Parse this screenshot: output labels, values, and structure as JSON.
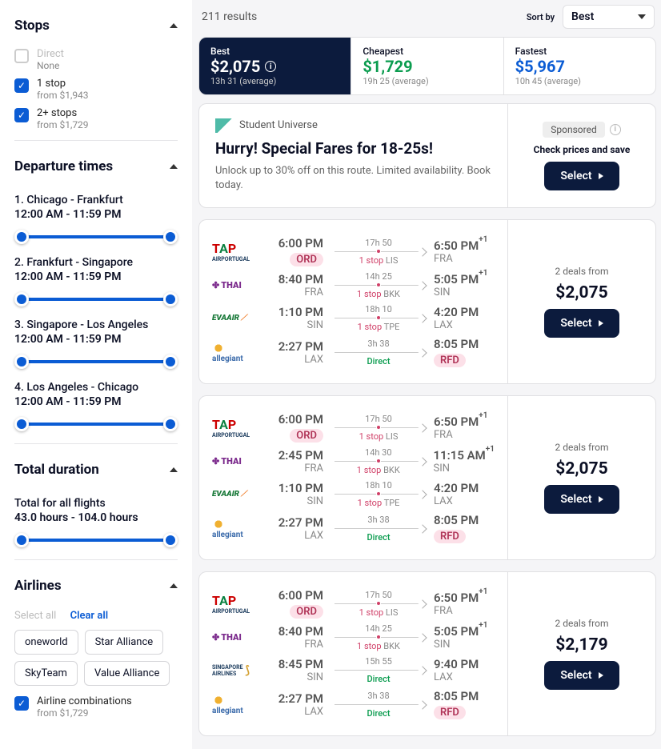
{
  "sidebar": {
    "stops": {
      "title": "Stops",
      "items": [
        {
          "label": "Direct",
          "sub": "None",
          "checked": false,
          "disabled": true
        },
        {
          "label": "1 stop",
          "sub": "from $1,943",
          "checked": true
        },
        {
          "label": "2+ stops",
          "sub": "from $1,729",
          "checked": true
        }
      ]
    },
    "departure": {
      "title": "Departure times",
      "legs": [
        {
          "label": "1. Chicago - Frankfurt",
          "range": "12:00 AM - 11:59 PM"
        },
        {
          "label": "2. Frankfurt - Singapore",
          "range": "12:00 AM - 11:59 PM"
        },
        {
          "label": "3. Singapore - Los Angeles",
          "range": "12:00 AM - 11:59 PM"
        },
        {
          "label": "4. Los Angeles - Chicago",
          "range": "12:00 AM - 11:59 PM"
        }
      ]
    },
    "duration": {
      "title": "Total duration",
      "label": "Total for all flights",
      "range": "43.0 hours - 104.0 hours"
    },
    "airlines": {
      "title": "Airlines",
      "select_all": "Select all",
      "clear_all": "Clear all",
      "chips": [
        "oneworld",
        "Star Alliance",
        "SkyTeam",
        "Value Alliance"
      ],
      "combo": {
        "label": "Airline combinations",
        "sub": "from $1,729"
      }
    }
  },
  "topbar": {
    "results": "211 results",
    "sortby": "Sort by",
    "sort": "Best"
  },
  "tabs": [
    {
      "label": "Best",
      "price": "$2,075",
      "sub": "13h 31 (average)",
      "info": true
    },
    {
      "label": "Cheapest",
      "price": "$1,729",
      "sub": "19h 25 (average)"
    },
    {
      "label": "Fastest",
      "price": "$5,967",
      "sub": "10h 45 (average)"
    }
  ],
  "promo": {
    "brand": "Student\nUniverse",
    "headline": "Hurry! Special Fares for 18-25s!",
    "body": "Unlock up to 30% off on this route. Limited availability. Book today.",
    "sponsored": "Sponsored",
    "cta_text": "Check prices and save",
    "button": "Select"
  },
  "results": [
    {
      "deals": "2 deals from",
      "price": "$2,075",
      "button": "Select",
      "legs": [
        {
          "airline": "tap",
          "dep": "6:00 PM",
          "depCode": "ORD",
          "depPill": true,
          "dur": "17h 50",
          "stop": "1 stop",
          "via": "LIS",
          "arr": "6:50 PM",
          "arrSup": "+1",
          "arrCode": "FRA"
        },
        {
          "airline": "thai",
          "dep": "8:40 PM",
          "depCode": "FRA",
          "dur": "14h 25",
          "stop": "1 stop",
          "via": "BKK",
          "arr": "5:05 PM",
          "arrSup": "+1",
          "arrCode": "SIN"
        },
        {
          "airline": "eva",
          "dep": "1:10 PM",
          "depCode": "SIN",
          "dur": "18h 10",
          "stop": "1 stop",
          "via": "TPE",
          "arr": "4:20 PM",
          "arrCode": "LAX"
        },
        {
          "airline": "allegiant",
          "dep": "2:27 PM",
          "depCode": "LAX",
          "dur": "3h 38",
          "direct": true,
          "arr": "8:05 PM",
          "arrCode": "RFD",
          "arrPill": true
        }
      ]
    },
    {
      "deals": "2 deals from",
      "price": "$2,075",
      "button": "Select",
      "legs": [
        {
          "airline": "tap",
          "dep": "6:00 PM",
          "depCode": "ORD",
          "depPill": true,
          "dur": "17h 50",
          "stop": "1 stop",
          "via": "LIS",
          "arr": "6:50 PM",
          "arrSup": "+1",
          "arrCode": "FRA"
        },
        {
          "airline": "thai",
          "dep": "2:45 PM",
          "depCode": "FRA",
          "dur": "14h 30",
          "stop": "1 stop",
          "via": "BKK",
          "arr": "11:15 AM",
          "arrSup": "+1",
          "arrCode": "SIN"
        },
        {
          "airline": "eva",
          "dep": "1:10 PM",
          "depCode": "SIN",
          "dur": "18h 10",
          "stop": "1 stop",
          "via": "TPE",
          "arr": "4:20 PM",
          "arrCode": "LAX"
        },
        {
          "airline": "allegiant",
          "dep": "2:27 PM",
          "depCode": "LAX",
          "dur": "3h 38",
          "direct": true,
          "arr": "8:05 PM",
          "arrCode": "RFD",
          "arrPill": true
        }
      ]
    },
    {
      "deals": "2 deals from",
      "price": "$2,179",
      "button": "Select",
      "legs": [
        {
          "airline": "tap",
          "dep": "6:00 PM",
          "depCode": "ORD",
          "depPill": true,
          "dur": "17h 50",
          "stop": "1 stop",
          "via": "LIS",
          "arr": "6:50 PM",
          "arrSup": "+1",
          "arrCode": "FRA"
        },
        {
          "airline": "thai",
          "dep": "8:40 PM",
          "depCode": "FRA",
          "dur": "14h 25",
          "stop": "1 stop",
          "via": "BKK",
          "arr": "5:05 PM",
          "arrSup": "+1",
          "arrCode": "SIN"
        },
        {
          "airline": "sq",
          "dep": "8:45 PM",
          "depCode": "SIN",
          "dur": "15h 55",
          "direct": true,
          "arr": "9:40 PM",
          "arrCode": "LAX"
        },
        {
          "airline": "allegiant",
          "dep": "2:27 PM",
          "depCode": "LAX",
          "dur": "3h 38",
          "direct": true,
          "arr": "8:05 PM",
          "arrCode": "RFD",
          "arrPill": true
        }
      ]
    }
  ],
  "labels": {
    "direct": "Direct"
  }
}
